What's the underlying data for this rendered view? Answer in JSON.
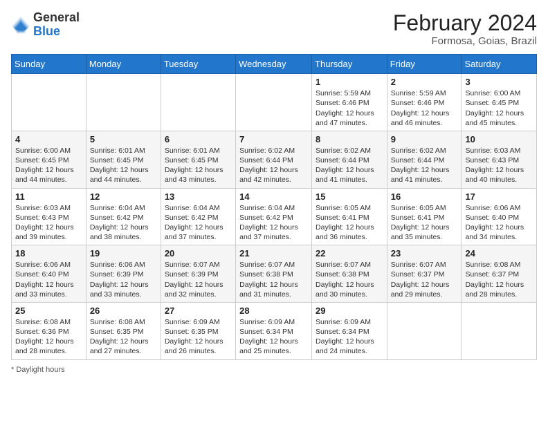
{
  "header": {
    "logo_general": "General",
    "logo_blue": "Blue",
    "month_year": "February 2024",
    "location": "Formosa, Goias, Brazil"
  },
  "days_of_week": [
    "Sunday",
    "Monday",
    "Tuesday",
    "Wednesday",
    "Thursday",
    "Friday",
    "Saturday"
  ],
  "weeks": [
    [
      {
        "num": "",
        "info": ""
      },
      {
        "num": "",
        "info": ""
      },
      {
        "num": "",
        "info": ""
      },
      {
        "num": "",
        "info": ""
      },
      {
        "num": "1",
        "info": "Sunrise: 5:59 AM\nSunset: 6:46 PM\nDaylight: 12 hours and 47 minutes."
      },
      {
        "num": "2",
        "info": "Sunrise: 5:59 AM\nSunset: 6:46 PM\nDaylight: 12 hours and 46 minutes."
      },
      {
        "num": "3",
        "info": "Sunrise: 6:00 AM\nSunset: 6:45 PM\nDaylight: 12 hours and 45 minutes."
      }
    ],
    [
      {
        "num": "4",
        "info": "Sunrise: 6:00 AM\nSunset: 6:45 PM\nDaylight: 12 hours and 44 minutes."
      },
      {
        "num": "5",
        "info": "Sunrise: 6:01 AM\nSunset: 6:45 PM\nDaylight: 12 hours and 44 minutes."
      },
      {
        "num": "6",
        "info": "Sunrise: 6:01 AM\nSunset: 6:45 PM\nDaylight: 12 hours and 43 minutes."
      },
      {
        "num": "7",
        "info": "Sunrise: 6:02 AM\nSunset: 6:44 PM\nDaylight: 12 hours and 42 minutes."
      },
      {
        "num": "8",
        "info": "Sunrise: 6:02 AM\nSunset: 6:44 PM\nDaylight: 12 hours and 41 minutes."
      },
      {
        "num": "9",
        "info": "Sunrise: 6:02 AM\nSunset: 6:44 PM\nDaylight: 12 hours and 41 minutes."
      },
      {
        "num": "10",
        "info": "Sunrise: 6:03 AM\nSunset: 6:43 PM\nDaylight: 12 hours and 40 minutes."
      }
    ],
    [
      {
        "num": "11",
        "info": "Sunrise: 6:03 AM\nSunset: 6:43 PM\nDaylight: 12 hours and 39 minutes."
      },
      {
        "num": "12",
        "info": "Sunrise: 6:04 AM\nSunset: 6:42 PM\nDaylight: 12 hours and 38 minutes."
      },
      {
        "num": "13",
        "info": "Sunrise: 6:04 AM\nSunset: 6:42 PM\nDaylight: 12 hours and 37 minutes."
      },
      {
        "num": "14",
        "info": "Sunrise: 6:04 AM\nSunset: 6:42 PM\nDaylight: 12 hours and 37 minutes."
      },
      {
        "num": "15",
        "info": "Sunrise: 6:05 AM\nSunset: 6:41 PM\nDaylight: 12 hours and 36 minutes."
      },
      {
        "num": "16",
        "info": "Sunrise: 6:05 AM\nSunset: 6:41 PM\nDaylight: 12 hours and 35 minutes."
      },
      {
        "num": "17",
        "info": "Sunrise: 6:06 AM\nSunset: 6:40 PM\nDaylight: 12 hours and 34 minutes."
      }
    ],
    [
      {
        "num": "18",
        "info": "Sunrise: 6:06 AM\nSunset: 6:40 PM\nDaylight: 12 hours and 33 minutes."
      },
      {
        "num": "19",
        "info": "Sunrise: 6:06 AM\nSunset: 6:39 PM\nDaylight: 12 hours and 33 minutes."
      },
      {
        "num": "20",
        "info": "Sunrise: 6:07 AM\nSunset: 6:39 PM\nDaylight: 12 hours and 32 minutes."
      },
      {
        "num": "21",
        "info": "Sunrise: 6:07 AM\nSunset: 6:38 PM\nDaylight: 12 hours and 31 minutes."
      },
      {
        "num": "22",
        "info": "Sunrise: 6:07 AM\nSunset: 6:38 PM\nDaylight: 12 hours and 30 minutes."
      },
      {
        "num": "23",
        "info": "Sunrise: 6:07 AM\nSunset: 6:37 PM\nDaylight: 12 hours and 29 minutes."
      },
      {
        "num": "24",
        "info": "Sunrise: 6:08 AM\nSunset: 6:37 PM\nDaylight: 12 hours and 28 minutes."
      }
    ],
    [
      {
        "num": "25",
        "info": "Sunrise: 6:08 AM\nSunset: 6:36 PM\nDaylight: 12 hours and 28 minutes."
      },
      {
        "num": "26",
        "info": "Sunrise: 6:08 AM\nSunset: 6:35 PM\nDaylight: 12 hours and 27 minutes."
      },
      {
        "num": "27",
        "info": "Sunrise: 6:09 AM\nSunset: 6:35 PM\nDaylight: 12 hours and 26 minutes."
      },
      {
        "num": "28",
        "info": "Sunrise: 6:09 AM\nSunset: 6:34 PM\nDaylight: 12 hours and 25 minutes."
      },
      {
        "num": "29",
        "info": "Sunrise: 6:09 AM\nSunset: 6:34 PM\nDaylight: 12 hours and 24 minutes."
      },
      {
        "num": "",
        "info": ""
      },
      {
        "num": "",
        "info": ""
      }
    ]
  ],
  "footer": "* Daylight hours"
}
